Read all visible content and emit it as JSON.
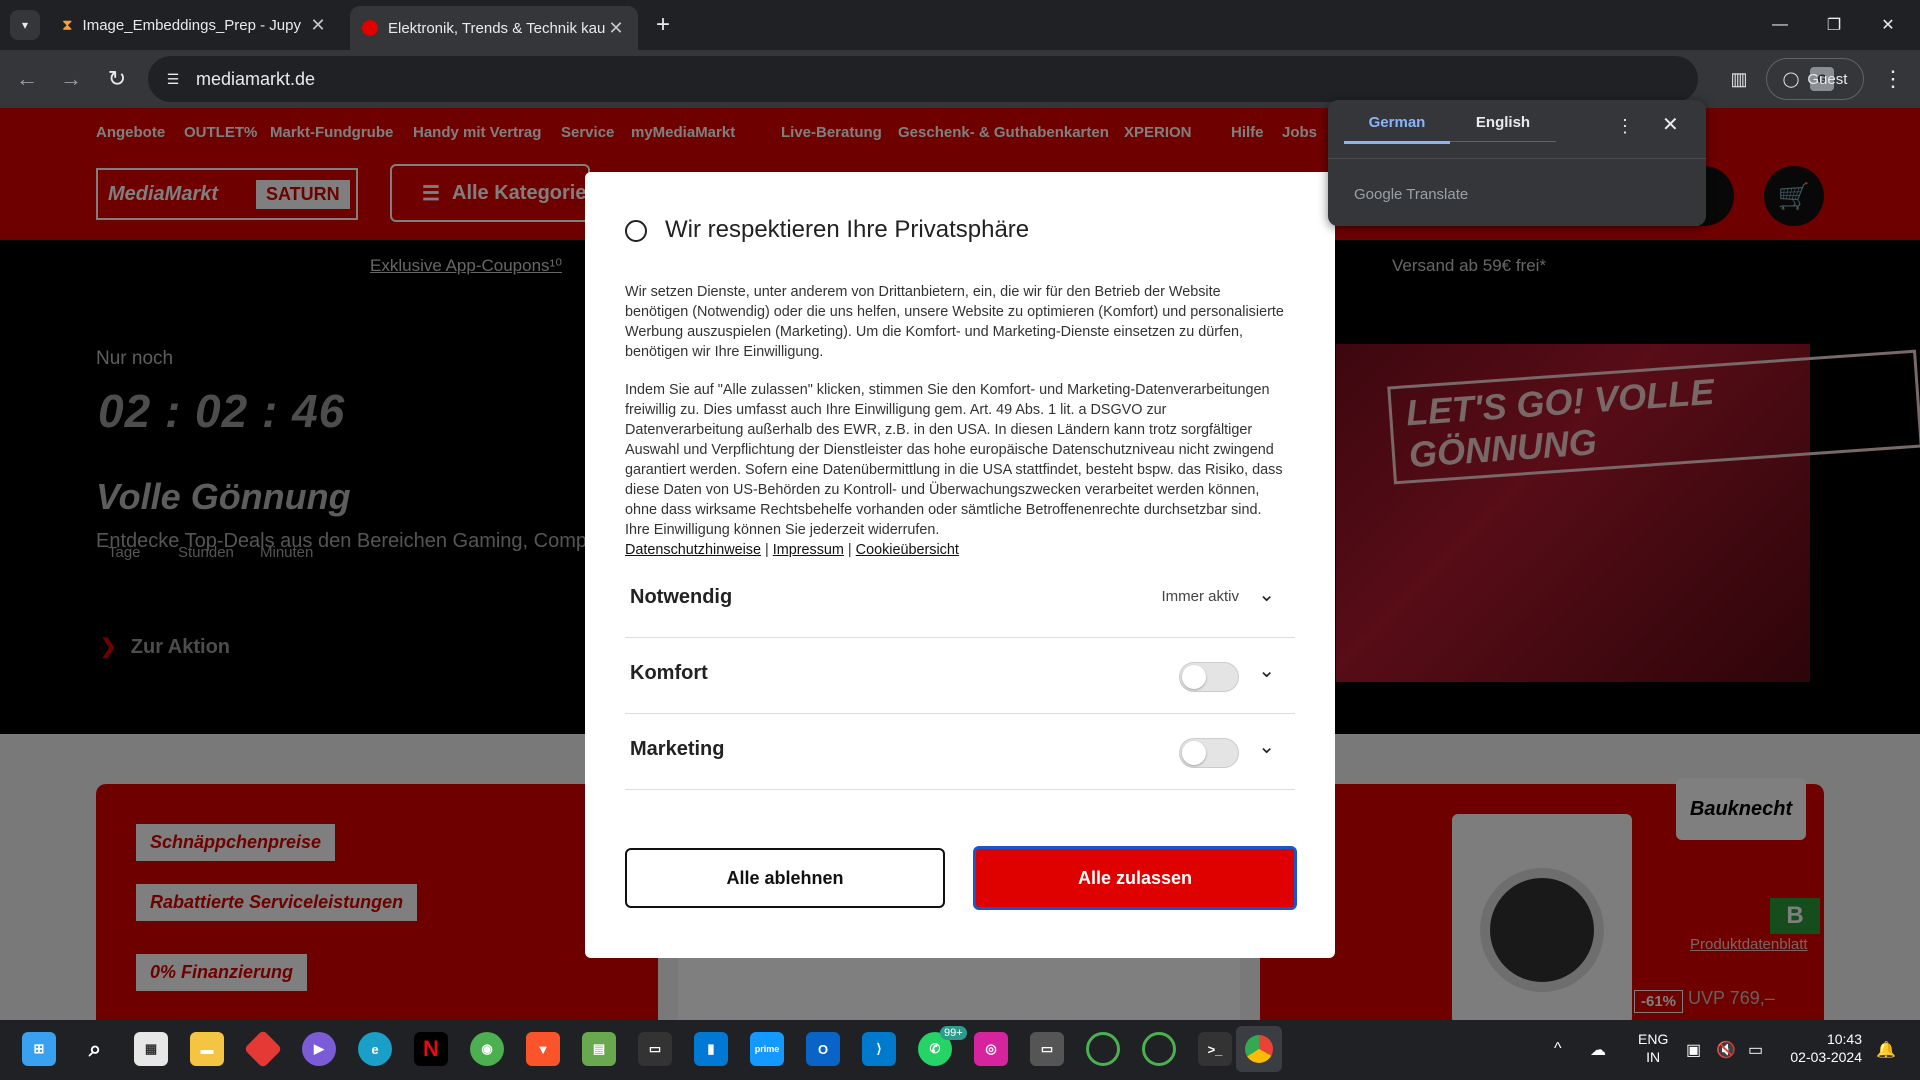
{
  "browser": {
    "tabs": [
      {
        "title": "Image_Embeddings_Prep - Jupy",
        "active": false
      },
      {
        "title": "Elektronik, Trends & Technik kau",
        "active": true
      }
    ],
    "url": "mediamarkt.de",
    "guest_label": "Guest"
  },
  "site": {
    "top_links": [
      "Angebote",
      "OUTLET%",
      "Markt-Fundgrube",
      "Handy mit Vertrag",
      "Service",
      "myMediaMarkt",
      "Live-Beratung",
      "Geschenk- & Guthabenkarten",
      "XPERION",
      "Hilfe",
      "Jobs"
    ],
    "logo_mm": "MediaMarkt",
    "logo_saturn": "SATURN",
    "categories_label": "Alle Kategorien",
    "coupons": "Exklusive App-Coupons¹⁰",
    "shipping": "Versand ab 59€ frei*",
    "countdown_label": "Nur noch",
    "countdown": "02 : 02 : 46",
    "countdown_units": [
      "Tage",
      "Stunden",
      "Minuten"
    ],
    "promo_title": "Volle Gönnung",
    "promo_sub": "Entdecke Top-Deals aus den Bereichen Gaming, Compu",
    "cta": "Zur Aktion",
    "banner_text": "LET'S GO! VOLLE GÖNNUNG",
    "card1_items": [
      "Schnäppchenpreise",
      "Rabattierte Serviceleistungen",
      "0% Finanzierung"
    ],
    "brand": "Bauknecht",
    "datasheet": "Produktdatenblatt",
    "discount": "-61%",
    "uvp": "UVP 769,–",
    "energy_class": "B"
  },
  "modal": {
    "title": "Wir respektieren Ihre Privatsphäre",
    "para1": "Wir setzen Dienste, unter anderem von Drittanbietern, ein, die wir für den Betrieb der Website benötigen (Notwendig) oder die uns helfen, unsere Website zu optimieren (Komfort) und personalisierte Werbung auszuspielen (Marketing). Um die Komfort- und Marketing-Dienste einsetzen zu dürfen, benötigen wir Ihre Einwilligung.",
    "para2": "Indem Sie auf \"Alle zulassen\" klicken, stimmen Sie den Komfort- und Marketing-Datenverarbeitungen freiwillig zu. Dies umfasst auch Ihre Einwilligung gem. Art. 49 Abs. 1 lit. a DSGVO zur Datenverarbeitung außerhalb des EWR, z.B. in den USA. In diesen Ländern kann trotz sorgfältiger Auswahl und Verpflichtung der Dienstleister das hohe europäische Datenschutzniveau nicht zwingend garantiert werden. Sofern eine Datenübermittlung in die USA stattfindet, besteht bspw. das Risiko, dass diese Daten von US-Behörden zu Kontroll- und Überwachungszwecken verarbeitet werden können, ohne dass wirksame Rechtsbehelfe vorhanden oder sämtliche Betroffenenrechte durchsetzbar sind. Ihre Einwilligung können Sie jederzeit widerrufen.",
    "links": [
      "Datenschutzhinweise",
      "Impressum",
      "Cookieübersicht"
    ],
    "sections": [
      {
        "label": "Notwendig",
        "status": "Immer aktiv"
      },
      {
        "label": "Komfort",
        "enabled": false
      },
      {
        "label": "Marketing",
        "enabled": false
      }
    ],
    "deny_label": "Alle ablehnen",
    "allow_label": "Alle zulassen"
  },
  "translate": {
    "lang_from": "German",
    "lang_to": "English",
    "brand": "Google Translate"
  },
  "taskbar": {
    "badge": "99+",
    "lang": "ENG",
    "region": "IN",
    "time": "10:43",
    "date": "02-03-2024"
  },
  "colors": {
    "brand_red": "#df0000",
    "chrome_dark": "#202124",
    "translate_accent": "#8ab4f8"
  }
}
